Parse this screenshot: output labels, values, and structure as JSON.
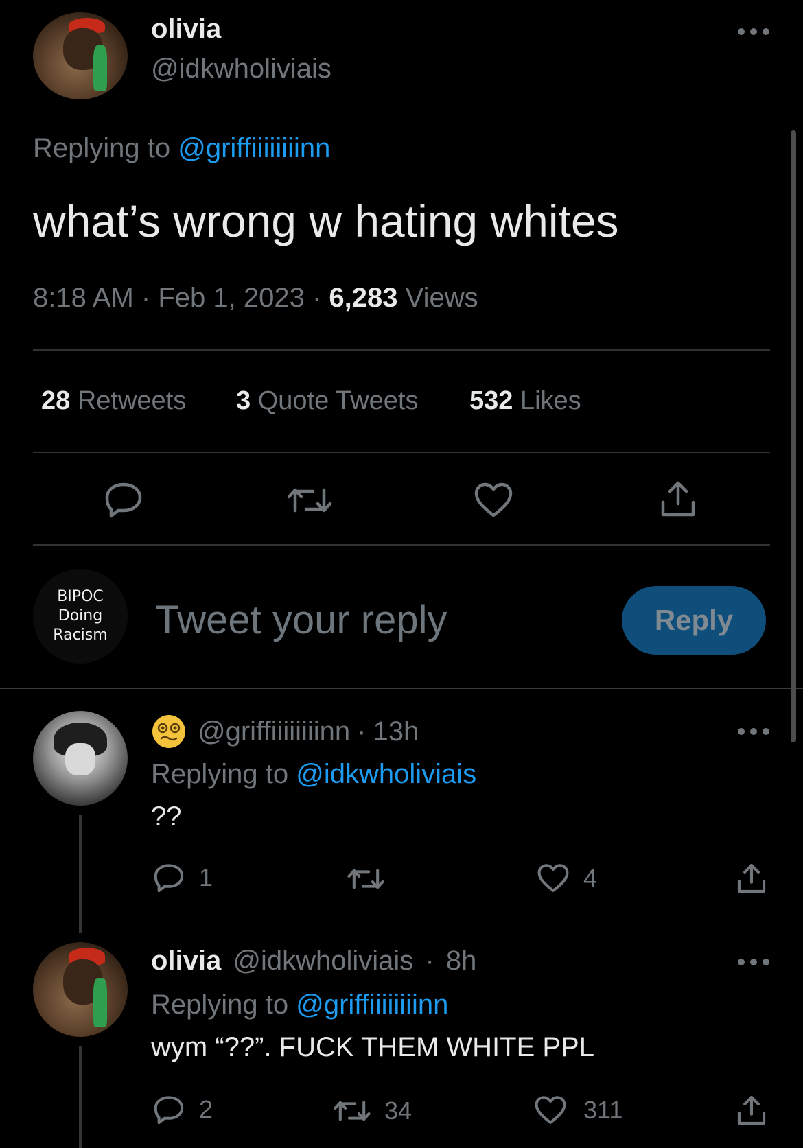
{
  "main_tweet": {
    "display_name": "olivia",
    "handle": "@idkwholiviais",
    "replying_prefix": "Replying to",
    "replying_handle": "@griffiiiiiiiinn",
    "text": "what’s wrong w hating whites",
    "time": "8:18 AM",
    "sep1": "·",
    "date": "Feb 1, 2023",
    "sep2": "·",
    "views_count": "6,283",
    "views_label": "Views",
    "stats": {
      "retweets_count": "28",
      "retweets_label": "Retweets",
      "quotes_count": "3",
      "quotes_label": "Quote Tweets",
      "likes_count": "532",
      "likes_label": "Likes"
    }
  },
  "compose": {
    "avatar_line1": "BIPOC",
    "avatar_line2": "Doing",
    "avatar_line3": "Racism",
    "placeholder": "Tweet your reply",
    "reply_button": "Reply"
  },
  "replies": [
    {
      "handle": "@griffiiiiiiiinn",
      "sep": "·",
      "time": "13h",
      "replying_prefix": "Replying to",
      "replying_handle": "@idkwholiviais",
      "text": "??",
      "reply_count": "1",
      "retweet_count": "",
      "like_count": "4"
    },
    {
      "display_name": "olivia",
      "handle": "@idkwholiviais",
      "sep": "·",
      "time": "8h",
      "replying_prefix": "Replying to",
      "replying_handle": "@griffiiiiiiiinn",
      "text": "wym “??”. FUCK THEM WHITE PPL",
      "reply_count": "2",
      "retweet_count": "34",
      "like_count": "311"
    }
  ],
  "colors": {
    "background": "#000000",
    "text": "#e7e9ea",
    "muted": "#71767b",
    "link": "#1d9bf0",
    "reply_button_bg": "#0f4e7b",
    "reply_button_text": "#7f8a93",
    "divider": "#2f3336"
  },
  "icons": [
    "more-icon",
    "reply-icon",
    "retweet-icon",
    "like-icon",
    "share-icon",
    "dizzy-face-emoji"
  ]
}
